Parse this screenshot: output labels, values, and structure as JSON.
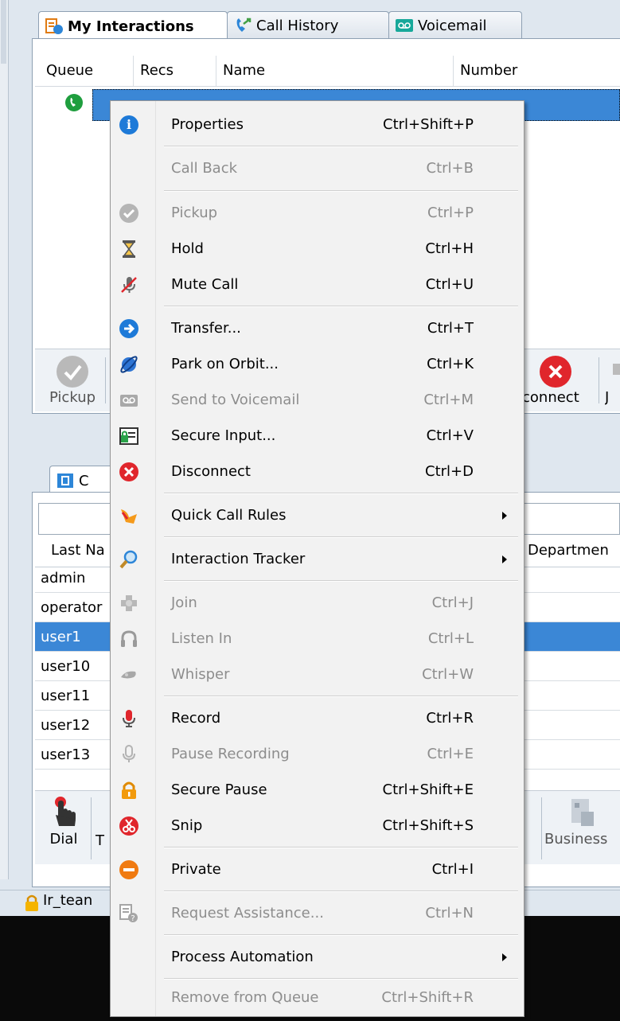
{
  "top_tabs": [
    {
      "label": "My Interactions",
      "icon": "interactions-icon"
    },
    {
      "label": "Call History",
      "icon": "call-history-icon"
    },
    {
      "label": "Voicemail",
      "icon": "voicemail-icon"
    }
  ],
  "interactions_grid": {
    "columns": [
      "Queue",
      "Recs",
      "Name",
      "Number"
    ]
  },
  "top_toolbar": {
    "pickup": "Pickup",
    "disconnect": "connect",
    "join": "J"
  },
  "bottom_tab": {
    "label": "C"
  },
  "directory_grid": {
    "columns": [
      "Last Na",
      "Departmen"
    ],
    "rows": [
      "admin",
      "operator",
      "user1",
      "user10",
      "user11",
      "user12",
      "user13"
    ],
    "selected_index": 2
  },
  "bottom_toolbar": {
    "dial": "Dial",
    "t": "T",
    "business": "Business"
  },
  "status_bar": {
    "text": "Ir_tean"
  },
  "context_menu": {
    "items": [
      {
        "label": "Properties",
        "shortcut": "Ctrl+Shift+P",
        "icon": "info-icon",
        "enabled": true
      },
      {
        "label": "Call Back",
        "shortcut": "Ctrl+B",
        "icon": "",
        "enabled": false
      },
      {
        "label": "Pickup",
        "shortcut": "Ctrl+P",
        "icon": "checkmark-icon",
        "enabled": false
      },
      {
        "label": "Hold",
        "shortcut": "Ctrl+H",
        "icon": "hourglass-icon",
        "enabled": true
      },
      {
        "label": "Mute Call",
        "shortcut": "Ctrl+U",
        "icon": "mute-mic-icon",
        "enabled": true
      },
      {
        "label": "Transfer...",
        "shortcut": "Ctrl+T",
        "icon": "transfer-arrow-icon",
        "enabled": true
      },
      {
        "label": "Park on Orbit...",
        "shortcut": "Ctrl+K",
        "icon": "orbit-icon",
        "enabled": true
      },
      {
        "label": "Send to Voicemail",
        "shortcut": "Ctrl+M",
        "icon": "voicemail-icon",
        "enabled": false
      },
      {
        "label": "Secure Input...",
        "shortcut": "Ctrl+V",
        "icon": "secure-input-icon",
        "enabled": true
      },
      {
        "label": "Disconnect",
        "shortcut": "Ctrl+D",
        "icon": "disconnect-icon",
        "enabled": true
      },
      {
        "label": "Quick Call Rules",
        "shortcut": "",
        "icon": "quick-call-rules-icon",
        "enabled": true,
        "submenu": true
      },
      {
        "label": "Interaction Tracker",
        "shortcut": "",
        "icon": "magnifier-icon",
        "enabled": true,
        "submenu": true
      },
      {
        "label": "Join",
        "shortcut": "Ctrl+J",
        "icon": "join-icon",
        "enabled": false
      },
      {
        "label": "Listen In",
        "shortcut": "Ctrl+L",
        "icon": "headphones-icon",
        "enabled": false
      },
      {
        "label": "Whisper",
        "shortcut": "Ctrl+W",
        "icon": "whisper-icon",
        "enabled": false
      },
      {
        "label": "Record",
        "shortcut": "Ctrl+R",
        "icon": "record-mic-icon",
        "enabled": true
      },
      {
        "label": "Pause Recording",
        "shortcut": "Ctrl+E",
        "icon": "pause-mic-icon",
        "enabled": false
      },
      {
        "label": "Secure Pause",
        "shortcut": "Ctrl+Shift+E",
        "icon": "padlock-icon",
        "enabled": true
      },
      {
        "label": "Snip",
        "shortcut": "Ctrl+Shift+S",
        "icon": "scissors-icon",
        "enabled": true
      },
      {
        "label": "Private",
        "shortcut": "Ctrl+I",
        "icon": "private-icon",
        "enabled": true
      },
      {
        "label": "Request Assistance...",
        "shortcut": "Ctrl+N",
        "icon": "request-assistance-icon",
        "enabled": false
      },
      {
        "label": "Process Automation",
        "shortcut": "",
        "icon": "",
        "enabled": true,
        "submenu": true
      },
      {
        "label": "Remove from Queue",
        "shortcut": "Ctrl+Shift+R",
        "icon": "",
        "enabled": false
      }
    ]
  }
}
